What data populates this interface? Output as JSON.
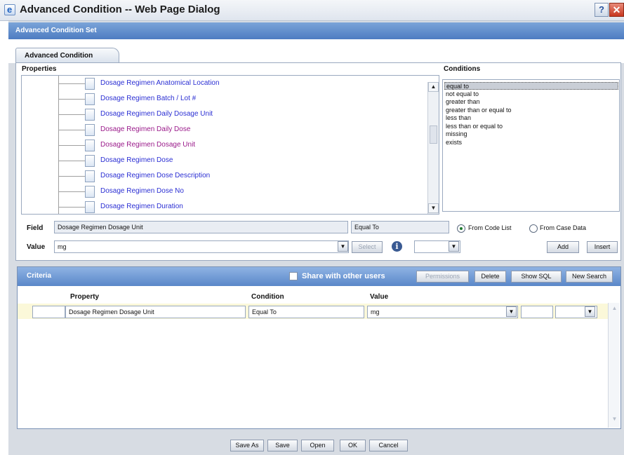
{
  "window": {
    "title": "Advanced Condition -- Web Page Dialog",
    "help_glyph": "?",
    "close_glyph": "✕"
  },
  "dialog": {
    "header": "Advanced Condition Set",
    "tab": "Advanced Condition"
  },
  "properties": {
    "label": "Properties",
    "items": [
      {
        "label": "Dosage Regimen Anatomical Location",
        "color": "#2b2fd3"
      },
      {
        "label": "Dosage Regimen Batch / Lot #",
        "color": "#2b2fd3"
      },
      {
        "label": "Dosage Regimen Daily Dosage Unit",
        "color": "#2b2fd3"
      },
      {
        "label": "Dosage Regimen Daily Dose",
        "color": "#9a1a8a"
      },
      {
        "label": "Dosage Regimen Dosage Unit",
        "color": "#9a1a8a"
      },
      {
        "label": "Dosage Regimen Dose",
        "color": "#2b2fd3"
      },
      {
        "label": "Dosage Regimen Dose Description",
        "color": "#2b2fd3"
      },
      {
        "label": "Dosage Regimen Dose No",
        "color": "#2b2fd3"
      },
      {
        "label": "Dosage Regimen Duration",
        "color": "#2b2fd3"
      }
    ]
  },
  "conditions": {
    "label": "Conditions",
    "items": [
      "equal to",
      "not equal to",
      "greater than",
      "greater than or equal to",
      "less than",
      "less than or equal to",
      "missing",
      "exists"
    ],
    "selected": "equal to"
  },
  "field_row": {
    "label": "Field",
    "field_value": "Dosage Regimen Dosage Unit",
    "condition_value": "Equal To",
    "radio_code_list": "From Code List",
    "radio_case_data": "From Case Data"
  },
  "value_row": {
    "label": "Value",
    "value": "mg",
    "select_button": "Select",
    "add_button": "Add",
    "insert_button": "Insert"
  },
  "criteria": {
    "title": "Criteria",
    "share_label": "Share with other users",
    "permissions_button": "Permissions",
    "delete_button": "Delete",
    "show_sql_button": "Show SQL",
    "new_search_button": "New Search",
    "columns": [
      "Property",
      "Condition",
      "Value"
    ],
    "row": {
      "property": "Dosage Regimen Dosage Unit",
      "condition": "Equal To",
      "value": "mg"
    }
  },
  "footer": {
    "buttons": [
      "Save As",
      "Save",
      "Open",
      "OK",
      "Cancel"
    ]
  },
  "icons": {
    "dropdown": "chevron-down-icon",
    "info": "info-icon",
    "scroll_up": "arrow-up-icon",
    "scroll_down": "arrow-down-icon"
  },
  "colors": {
    "header_blue": "#4d7cc2",
    "criteria_blue": "#5a87c9",
    "row_highlight": "#fbf8d9"
  }
}
